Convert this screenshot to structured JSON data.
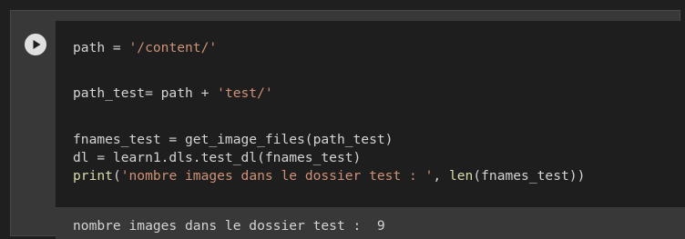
{
  "colors": {
    "editor_background": "#1e1e1e",
    "cell_background": "#383838",
    "default_text": "#d4d4d4",
    "string_token": "#ce9178",
    "function_token": "#dcdcaa",
    "run_button": "#e0e0e0"
  },
  "cell": {
    "run_button_icon": "play-icon",
    "code": {
      "line1": {
        "a": "path = ",
        "b": "'/content/'"
      },
      "line2": {
        "a": "path_test= path + ",
        "b": "'test/'"
      },
      "line3": {
        "a": "fnames_test = get_image_files(path_test)"
      },
      "line4": {
        "a": "dl = learn1.dls.test_dl(fnames_test)"
      },
      "line5": {
        "a": "print",
        "b": "(",
        "c": "'nombre images dans le dossier test : '",
        "d": ", ",
        "e": "len",
        "f": "(fnames_test))"
      }
    },
    "output": "nombre images dans le dossier test :  9"
  }
}
